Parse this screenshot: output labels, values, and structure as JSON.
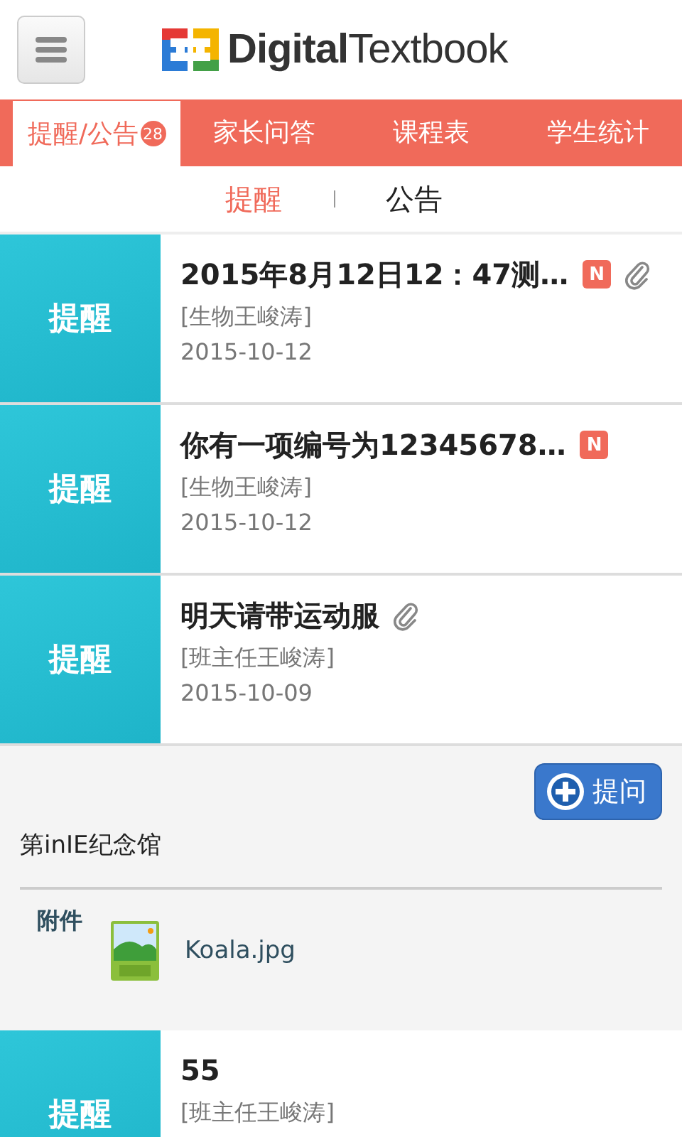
{
  "header": {
    "logo": "**Digital**Textbook"
  },
  "tabs": [
    {
      "label": "提醒/公告",
      "badge": "28",
      "selected": true
    },
    {
      "label": "家长问答",
      "selected": false
    },
    {
      "label": "课程表",
      "selected": false
    },
    {
      "label": "学生统计",
      "selected": false
    }
  ],
  "subtabs": [
    {
      "label": "提醒",
      "selected": true
    },
    {
      "label": "公告",
      "selected": false
    }
  ],
  "items": [
    {
      "tag": "提醒",
      "title": "2015年8月12日12：47测…",
      "badge": "N",
      "author": "[生物王峻涛]",
      "date": "2015-10-12",
      "attachment": true
    },
    {
      "tag": "提醒",
      "title": "你有一项编号为12345678…",
      "badge": "N",
      "author": "[生物王峻涛]",
      "date": "2015-10-12",
      "attachment": false
    },
    {
      "tag": "提醒",
      "title": "明天请带运动服",
      "author": "[班主任王峻涛]",
      "date": "2015-10-09",
      "attachment": true,
      "detail": {
        "button": "提问",
        "body": "第inIE纪念馆",
        "attachments_label": "附件",
        "files": [
          {
            "name": "Koala.jpg"
          }
        ]
      }
    },
    {
      "tag": "提醒",
      "title": "55",
      "author": "[班主任王峻涛]",
      "attachment": false
    }
  ]
}
